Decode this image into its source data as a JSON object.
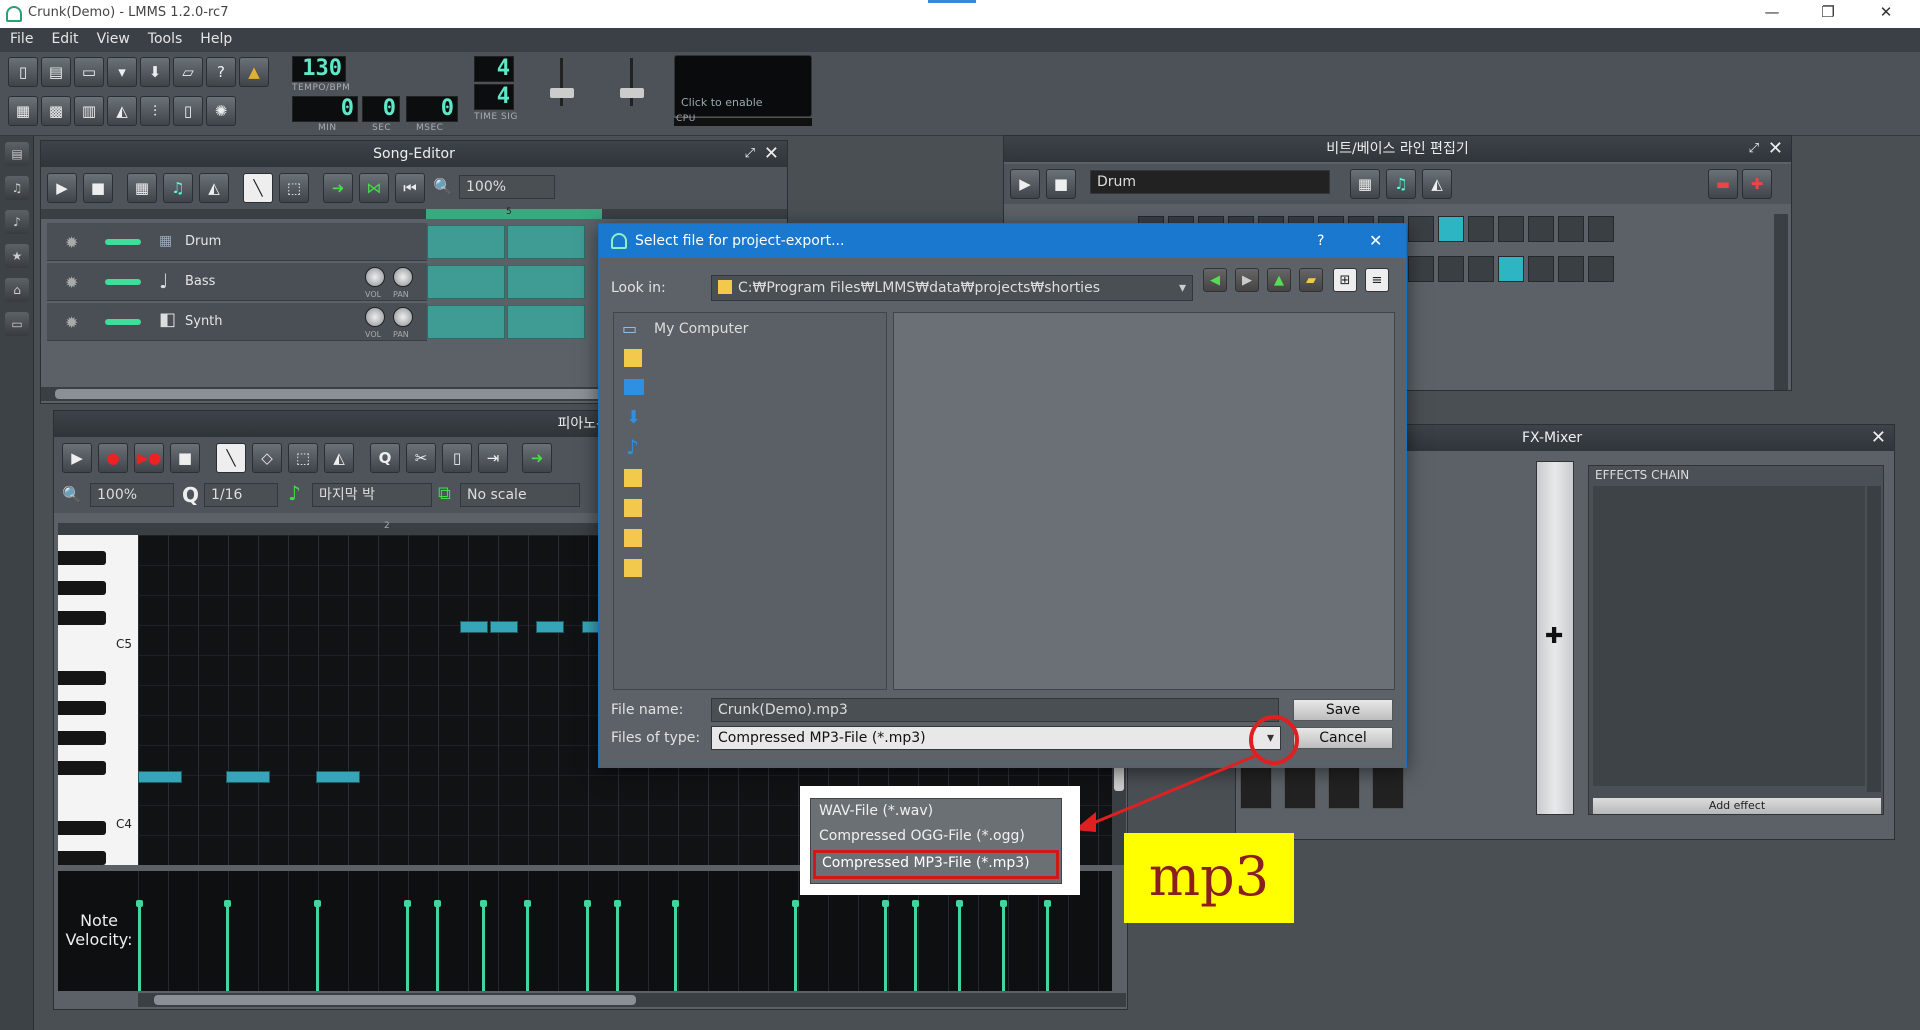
{
  "window": {
    "title": "Crunk(Demo) - LMMS 1.2.0-rc7",
    "controls": [
      "—",
      "❐",
      "✕"
    ]
  },
  "menu": [
    "File",
    "Edit",
    "View",
    "Tools",
    "Help"
  ],
  "toolbar": {
    "tempo": "130",
    "tempo_label": "TEMPO/BPM",
    "min": "0",
    "sec": "0",
    "msec": "0",
    "min_label": "MIN",
    "sec_label": "SEC",
    "msec_label": "MSEC",
    "timesig_top": "4",
    "timesig_bottom": "4",
    "timesig_label": "TIME SIG",
    "cpu_hint": "Click to enable",
    "cpu_label": "CPU"
  },
  "song_editor": {
    "title": "Song-Editor",
    "zoom": "100%",
    "timeline_marker": "5",
    "tracks": [
      {
        "name": "Drum"
      },
      {
        "name": "Bass",
        "vol": "VOL",
        "pan": "PAN"
      },
      {
        "name": "Synth",
        "vol": "VOL",
        "pan": "PAN"
      }
    ]
  },
  "beat_editor": {
    "title": "비트/베이스 라인 편집기",
    "selected": "Drum",
    "row1_on": [
      10
    ],
    "row2_on": [
      4,
      12
    ]
  },
  "piano_roll": {
    "title": "피아노-롤 -",
    "zoom": "100%",
    "quantize": "1/16",
    "note_length": "마지막 박",
    "scale": "No scale",
    "ruler_marker": "2",
    "key_labels": [
      "C5",
      "C4"
    ],
    "velocity_label": "Note Velocity:"
  },
  "dialog": {
    "title": "Select file for project-export...",
    "help": "?",
    "close": "✕",
    "look_in_label": "Look in:",
    "look_in_path": "C:₩Program Files₩LMMS₩data₩projects₩shorties",
    "sidebar_first": "My Computer",
    "file_name_label": "File name:",
    "file_name": "Crunk(Demo).mp3",
    "files_of_type_label": "Files of type:",
    "files_of_type": "Compressed MP3-File (*.mp3)",
    "save": "Save",
    "cancel": "Cancel"
  },
  "dropdown": {
    "options": [
      "WAV-File (*.wav)",
      "Compressed OGG-File (*.ogg)",
      "Compressed MP3-File (*.mp3)"
    ],
    "selected_index": 2
  },
  "annotation": {
    "label": "mp3",
    "color": "#e02020",
    "bg": "#ffff00"
  },
  "fx_mixer": {
    "title": "FX-Mixer",
    "effects_chain": "EFFECTS CHAIN",
    "add_effect": "Add effect"
  }
}
